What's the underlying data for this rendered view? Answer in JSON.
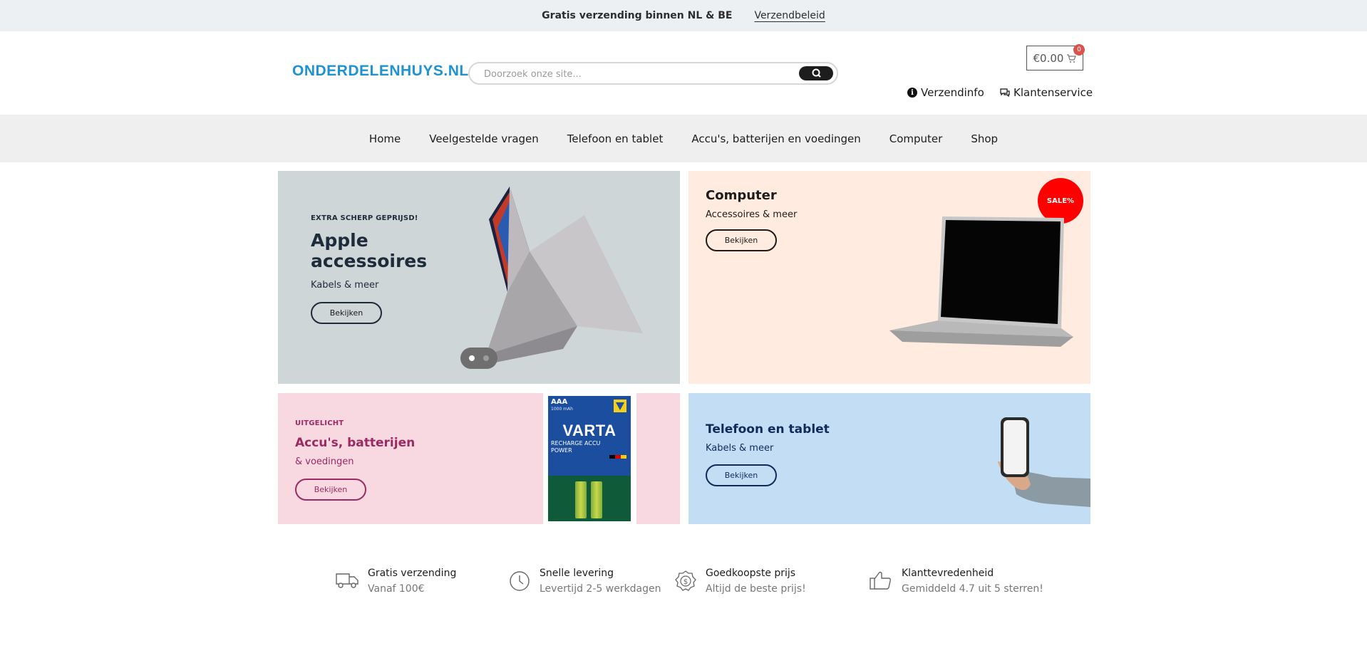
{
  "topbar": {
    "message": "Gratis verzending binnen NL & BE",
    "link": "Verzendbeleid"
  },
  "header": {
    "logo": "ONDERDELENHUYS.NL",
    "search_placeholder": "Doorzoek onze site...",
    "cart_total": "€0.00",
    "cart_count": "0",
    "links": {
      "shipping": "Verzendinfo",
      "service": "Klantenservice"
    }
  },
  "nav": {
    "items": [
      "Home",
      "Veelgestelde vragen",
      "Telefoon en tablet",
      "Accu's, batterijen en voedingen",
      "Computer",
      "Shop"
    ]
  },
  "banners": {
    "apple": {
      "kicker": "EXTRA SCHERP GEPRIJSD!",
      "title": "Apple accessoires",
      "subtitle": "Kabels & meer",
      "button": "Bekijken"
    },
    "computer": {
      "title": "Computer",
      "subtitle": "Accessoires & meer",
      "button": "Bekijken",
      "sale": "SALE%"
    },
    "batteries": {
      "kicker": "UITGELICHT",
      "title": "Accu's, batterijen",
      "subtitle": "& voedingen",
      "button": "Bekijken",
      "package": {
        "size": "AAA",
        "mah": "1000 mAh",
        "brand": "VARTA",
        "line": "RECHARGE ACCU POWER"
      }
    },
    "phone": {
      "title": "Telefoon en tablet",
      "subtitle": "Kabels & meer",
      "button": "Bekijken"
    }
  },
  "usps": [
    {
      "title": "Gratis verzending",
      "subtitle": "Vanaf 100€",
      "icon": "truck-icon"
    },
    {
      "title": "Snelle levering",
      "subtitle": "Levertijd 2-5 werkdagen",
      "icon": "clock-icon"
    },
    {
      "title": "Goedkoopste prijs",
      "subtitle": "Altijd de beste prijs!",
      "icon": "dollar-badge-icon"
    },
    {
      "title": "Klanttevredenheid",
      "subtitle": "Gemiddeld 4.7 uit 5 sterren!",
      "icon": "thumbs-up-icon"
    }
  ],
  "colors": {
    "logo": "#1f93cf",
    "sale": "#ff0000",
    "pink_text": "#9b2a63",
    "navy_text": "#102a5c"
  }
}
